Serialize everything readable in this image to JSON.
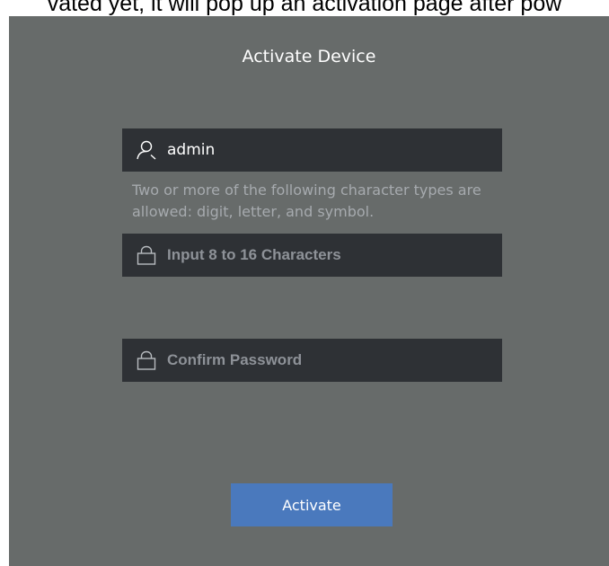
{
  "top_caption": "vated yet, it will pop up an activation page after pow",
  "dialog": {
    "title": "Activate Device",
    "username": {
      "value": "admin",
      "icon": "user-icon"
    },
    "password_hint": "Two or more of the following character types are allowed: digit, letter, and symbol.",
    "password": {
      "value": "",
      "placeholder": "Input 8 to 16 Characters",
      "icon": "lock-icon"
    },
    "confirm_password": {
      "value": "",
      "placeholder": "Confirm Password",
      "icon": "lock-icon"
    },
    "activate_label": "Activate"
  },
  "colors": {
    "background": "#676b6a",
    "field_background": "#2e3135",
    "button": "#4a79bd",
    "hint_text": "#a6aaae",
    "placeholder_text": "#8e9298"
  }
}
